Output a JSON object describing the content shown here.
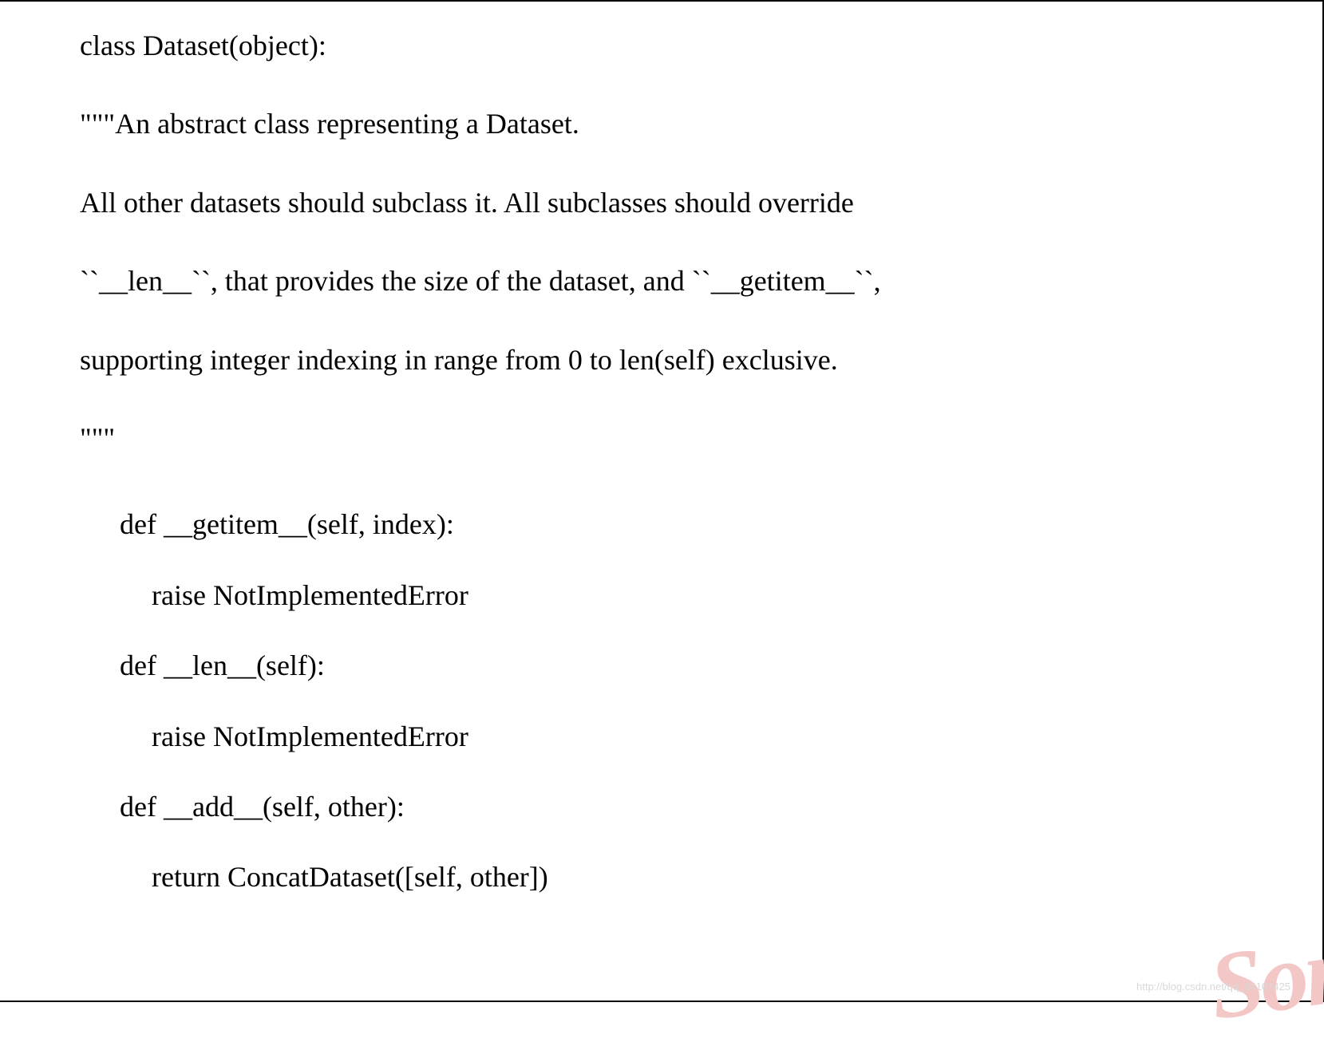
{
  "code": {
    "class_def": "class Dataset(object):",
    "docstring_open": "\"\"\"An abstract class representing a Dataset.",
    "docstring_line1": "All other datasets should subclass it. All subclasses should override",
    "docstring_line2": "``__len__``, that provides the size of the dataset, and ``__getitem__``,",
    "docstring_line3": "supporting integer indexing in range from 0 to len(self) exclusive.",
    "docstring_close": "\"\"\"",
    "method1_def": "def __getitem__(self, index):",
    "method1_body": "raise NotImplementedError",
    "method2_def": "def __len__(self):",
    "method2_body": "raise NotImplementedError",
    "method3_def": "def __add__(self, other):",
    "method3_body": "return ConcatDataset([self, other])"
  },
  "watermark": {
    "large": "Son",
    "small": "http://blog.csdn.net/qq_34107425"
  }
}
